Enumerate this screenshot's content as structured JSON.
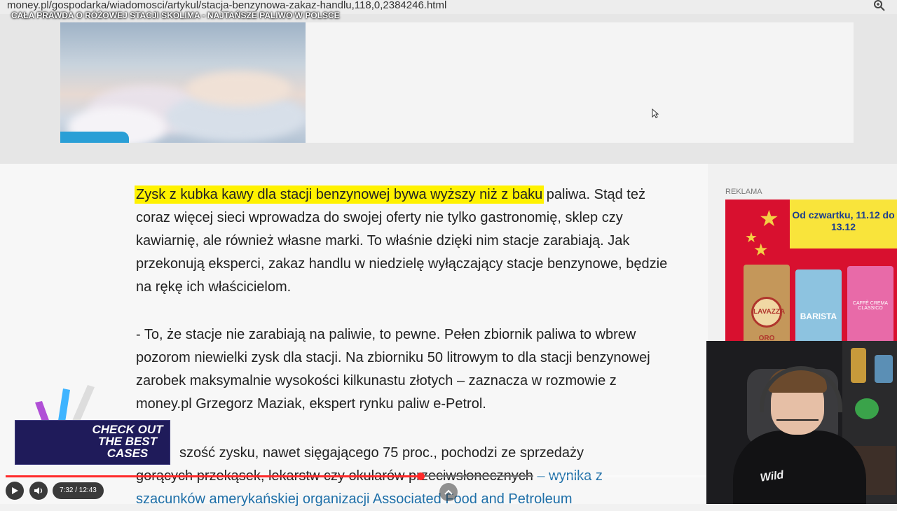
{
  "browser": {
    "url": "money.pl/gospodarka/wiadomosci/artykul/stacja-benzynowa-zakaz-handlu,118,0,2384246.html"
  },
  "video": {
    "title": "CAŁA PRAWDA O RÓŻOWEJ STACJI SKOLIMA - NAJTAŃSZE PALIWO W POLSCE",
    "time": "7:32 / 12:43",
    "progress": 0.5924
  },
  "article": {
    "para1_highlight": "Zysk z kubka kawy dla stacji benzynowej bywa wyższy niż z baku",
    "para1_rest": " paliwa. Stąd też coraz więcej sieci wprowadza do swojej oferty nie tylko gastronomię, sklep czy kawiarnię, ale również własne marki. To właśnie dzięki nim stacje zarabiają. Jak przekonują eksperci, zakaz handlu w niedzielę wyłączający stacje benzynowe, będzie na rękę ich właścicielom.",
    "para2": "- To, że stacje nie zarabiają na paliwie, to pewne. Pełen zbiornik paliwa to wbrew pozorom niewielki zysk dla stacji. Na zbiorniku 50 litrowym to dla stacji benzynowej zarobek maksymalnie wysokości kilkunastu złotych – zaznacza w rozmowie z money.pl Grzegorz Maziak, ekspert rynku paliw e-Petrol.",
    "para3_start": "szość zysku, nawet sięgającego 75 proc., pochodzi ze sprzedaży",
    "para3_line2": "gorących przekąsek, lekarstw czy okularów przeciwsłonecznych",
    "para3_link_a": " – wynika z",
    "para3_link_b": "szacunków amerykańskiej organizacji Associated Food and Petroleum"
  },
  "ad": {
    "label": "REKLAMA",
    "promo": "Od czwartku, 11.12 do 13.12",
    "pack_labels": [
      "LAVAZZA ORO",
      "BARISTA",
      "CAFFÈ CREMA CLASSICO"
    ]
  },
  "overlay": {
    "promo_text": "CHECK OUT THE BEST CASES",
    "hoodie_text": "Wild"
  },
  "colors": {
    "highlight": "#fff200",
    "link": "#1e6fa8",
    "progress": "#ff2a2a",
    "ad_red": "#d8102f",
    "ad_yellow": "#f9e43b"
  }
}
